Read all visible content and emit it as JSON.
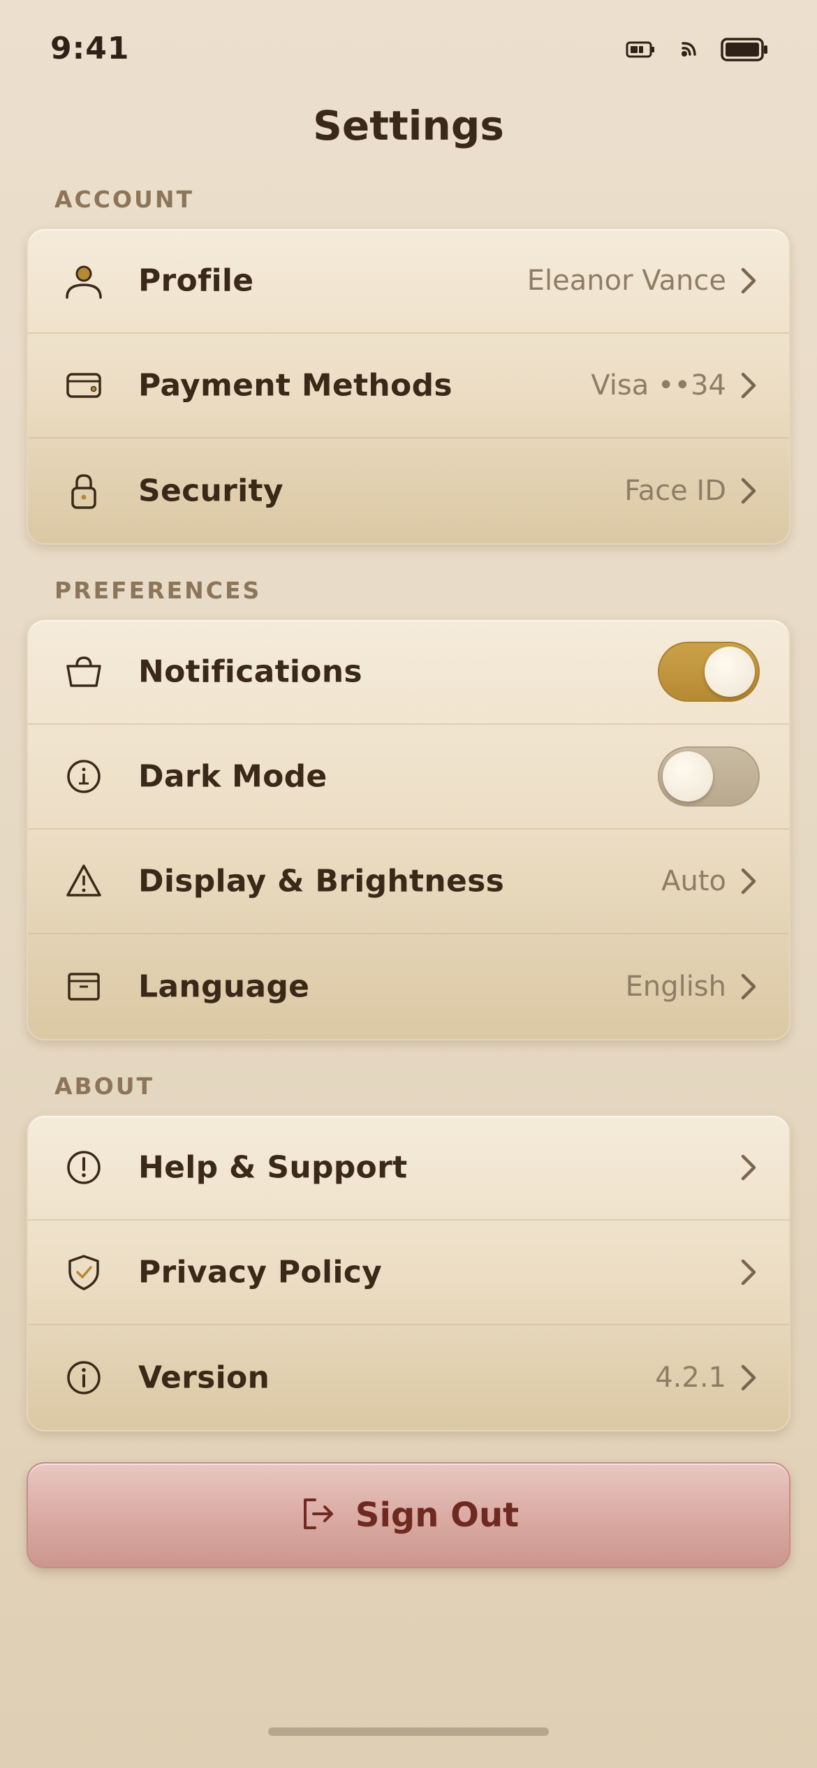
{
  "status_bar": {
    "time": "9:41",
    "icons": [
      "battery-small-icon",
      "signal-icon",
      "battery-icon"
    ]
  },
  "page_title": "Settings",
  "sections": {
    "account": {
      "header": "ACCOUNT",
      "rows": [
        {
          "icon": "person-icon",
          "label": "Profile",
          "value": "Eleanor Vance"
        },
        {
          "icon": "wallet-icon",
          "label": "Payment Methods",
          "value": "Visa ••34"
        },
        {
          "icon": "lock-icon",
          "label": "Security",
          "value": "Face ID"
        }
      ]
    },
    "preferences": {
      "header": "PREFERENCES",
      "rows": [
        {
          "icon": "basket-icon",
          "label": "Notifications",
          "toggle": true
        },
        {
          "icon": "info-down-icon",
          "label": "Dark Mode",
          "toggle": false
        },
        {
          "icon": "warning-icon",
          "label": "Display & Brightness",
          "value": "Auto"
        },
        {
          "icon": "archive-icon",
          "label": "Language",
          "value": "English"
        }
      ]
    },
    "about": {
      "header": "ABOUT",
      "rows": [
        {
          "icon": "exclamation-circle-icon",
          "label": "Help & Support",
          "value": ""
        },
        {
          "icon": "shield-check-icon",
          "label": "Privacy Policy",
          "value": ""
        },
        {
          "icon": "info-circle-icon",
          "label": "Version",
          "value": "4.2.1"
        }
      ]
    }
  },
  "sign_out": {
    "label": "Sign Out",
    "icon": "logout-icon"
  },
  "colors": {
    "accent": "#b68a34",
    "text": "#3a2918",
    "muted": "#8f7c66",
    "danger": "#6e2a20"
  }
}
